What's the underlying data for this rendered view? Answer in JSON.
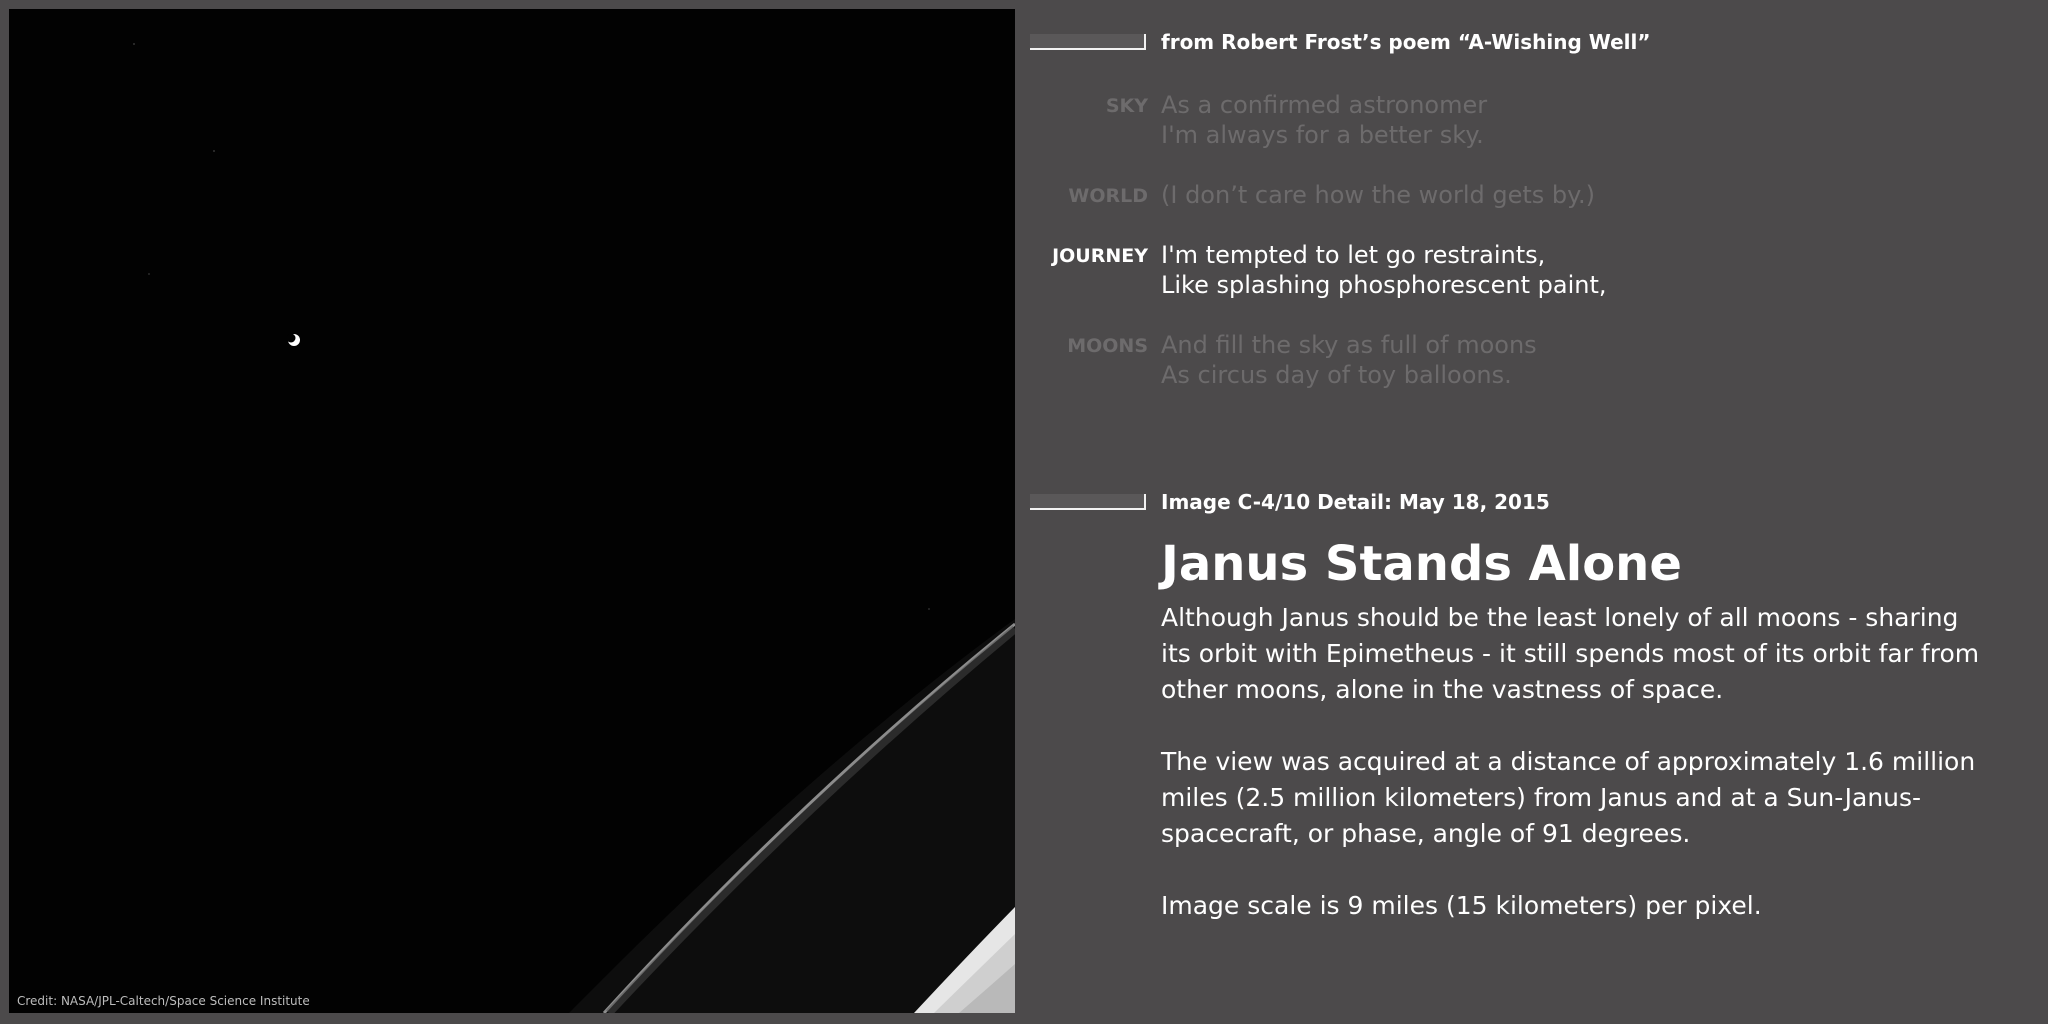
{
  "photo": {
    "credit": "Credit: NASA/JPL-Caltech/Space Science Institute"
  },
  "poem": {
    "header": "from Robert Frost’s poem “A-Wishing Well”",
    "stanzas": [
      {
        "label": "SKY",
        "lines": [
          "As a confirmed astronomer",
          "I'm always for a better sky."
        ]
      },
      {
        "label": "WORLD",
        "lines": [
          "(I don’t care how the world gets by.)"
        ]
      },
      {
        "label": "JOURNEY",
        "lines": [
          "I'm tempted to let go restraints,",
          "Like splashing phosphorescent paint,"
        ]
      },
      {
        "label": "MOONS",
        "lines": [
          "And fill the sky as full of moons",
          "As circus day of toy balloons."
        ]
      }
    ]
  },
  "article": {
    "header": "Image C-4/10 Detail: May 18, 2015",
    "title": "Janus Stands Alone",
    "paragraphs": [
      "Although Janus should be the least lonely of all moons - sharing its orbit with Epimetheus - it still spends most of its orbit far from other moons, alone in the vastness of space.",
      "The view was acquired at a distance of approximately 1.6 million miles (2.5 million kilometers) from Janus and at a Sun-Janus-spacecraft, or phase, angle of 91 degrees.",
      "Image scale is 9 miles (15 kilometers) per pixel."
    ]
  }
}
